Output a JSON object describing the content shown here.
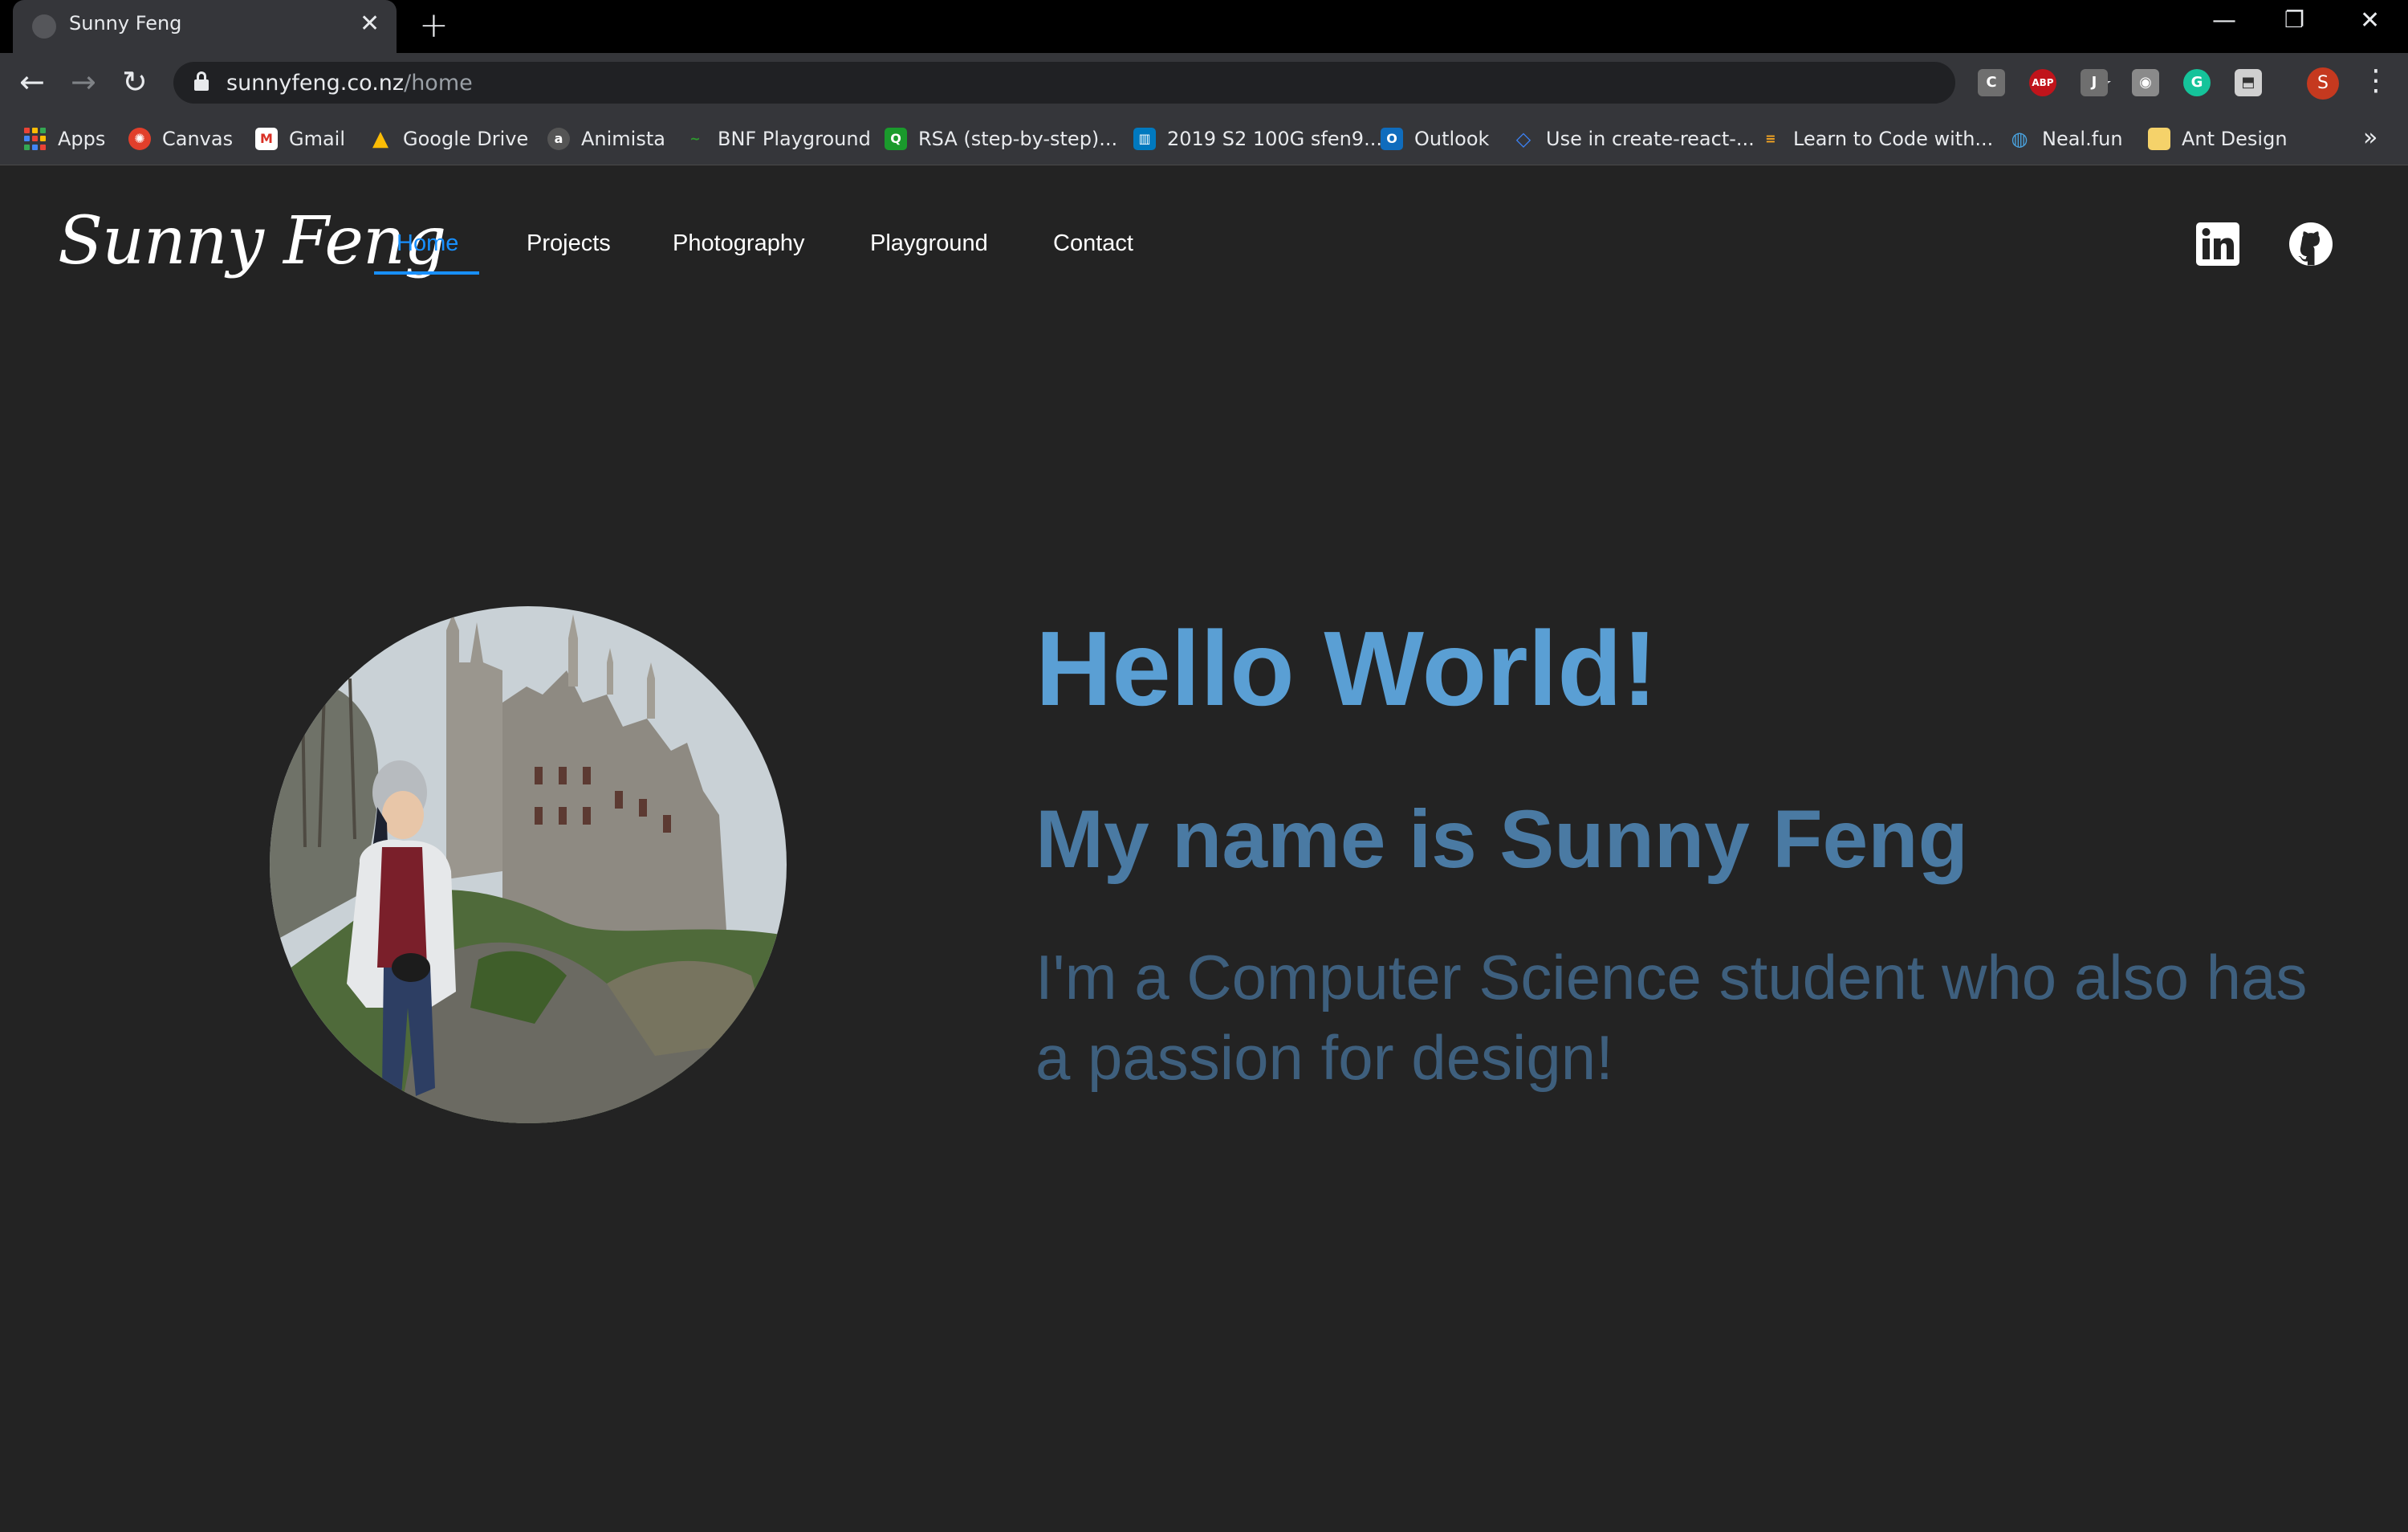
{
  "browser": {
    "tab_title": "Sunny Feng",
    "url_host": "sunnyfeng.co.nz",
    "url_path": "/home",
    "profile_initial": "S",
    "extensions": [
      "C",
      "ABP",
      "J"
    ],
    "bookmarks": [
      {
        "label": "Apps"
      },
      {
        "label": "Canvas"
      },
      {
        "label": "Gmail"
      },
      {
        "label": "Google Drive"
      },
      {
        "label": "Animista"
      },
      {
        "label": "BNF Playground"
      },
      {
        "label": "RSA (step-by-step)..."
      },
      {
        "label": "2019 S2 100G sfen9..."
      },
      {
        "label": "Outlook"
      },
      {
        "label": "Use in create-react-..."
      },
      {
        "label": "Learn to Code with..."
      },
      {
        "label": "Neal.fun"
      },
      {
        "label": "Ant Design"
      }
    ]
  },
  "site": {
    "logo": "Sunny Feng",
    "nav": [
      {
        "label": "Home",
        "active": true
      },
      {
        "label": "Projects"
      },
      {
        "label": "Photography"
      },
      {
        "label": "Playground"
      },
      {
        "label": "Contact"
      }
    ],
    "social": [
      "linkedin-icon",
      "github-icon"
    ],
    "accent_color": "#1890ff"
  },
  "hero": {
    "heading": "Hello World!",
    "subheading": "My name is Sunny Feng",
    "tagline": "I'm a Computer Science student who also has a passion for design!"
  }
}
